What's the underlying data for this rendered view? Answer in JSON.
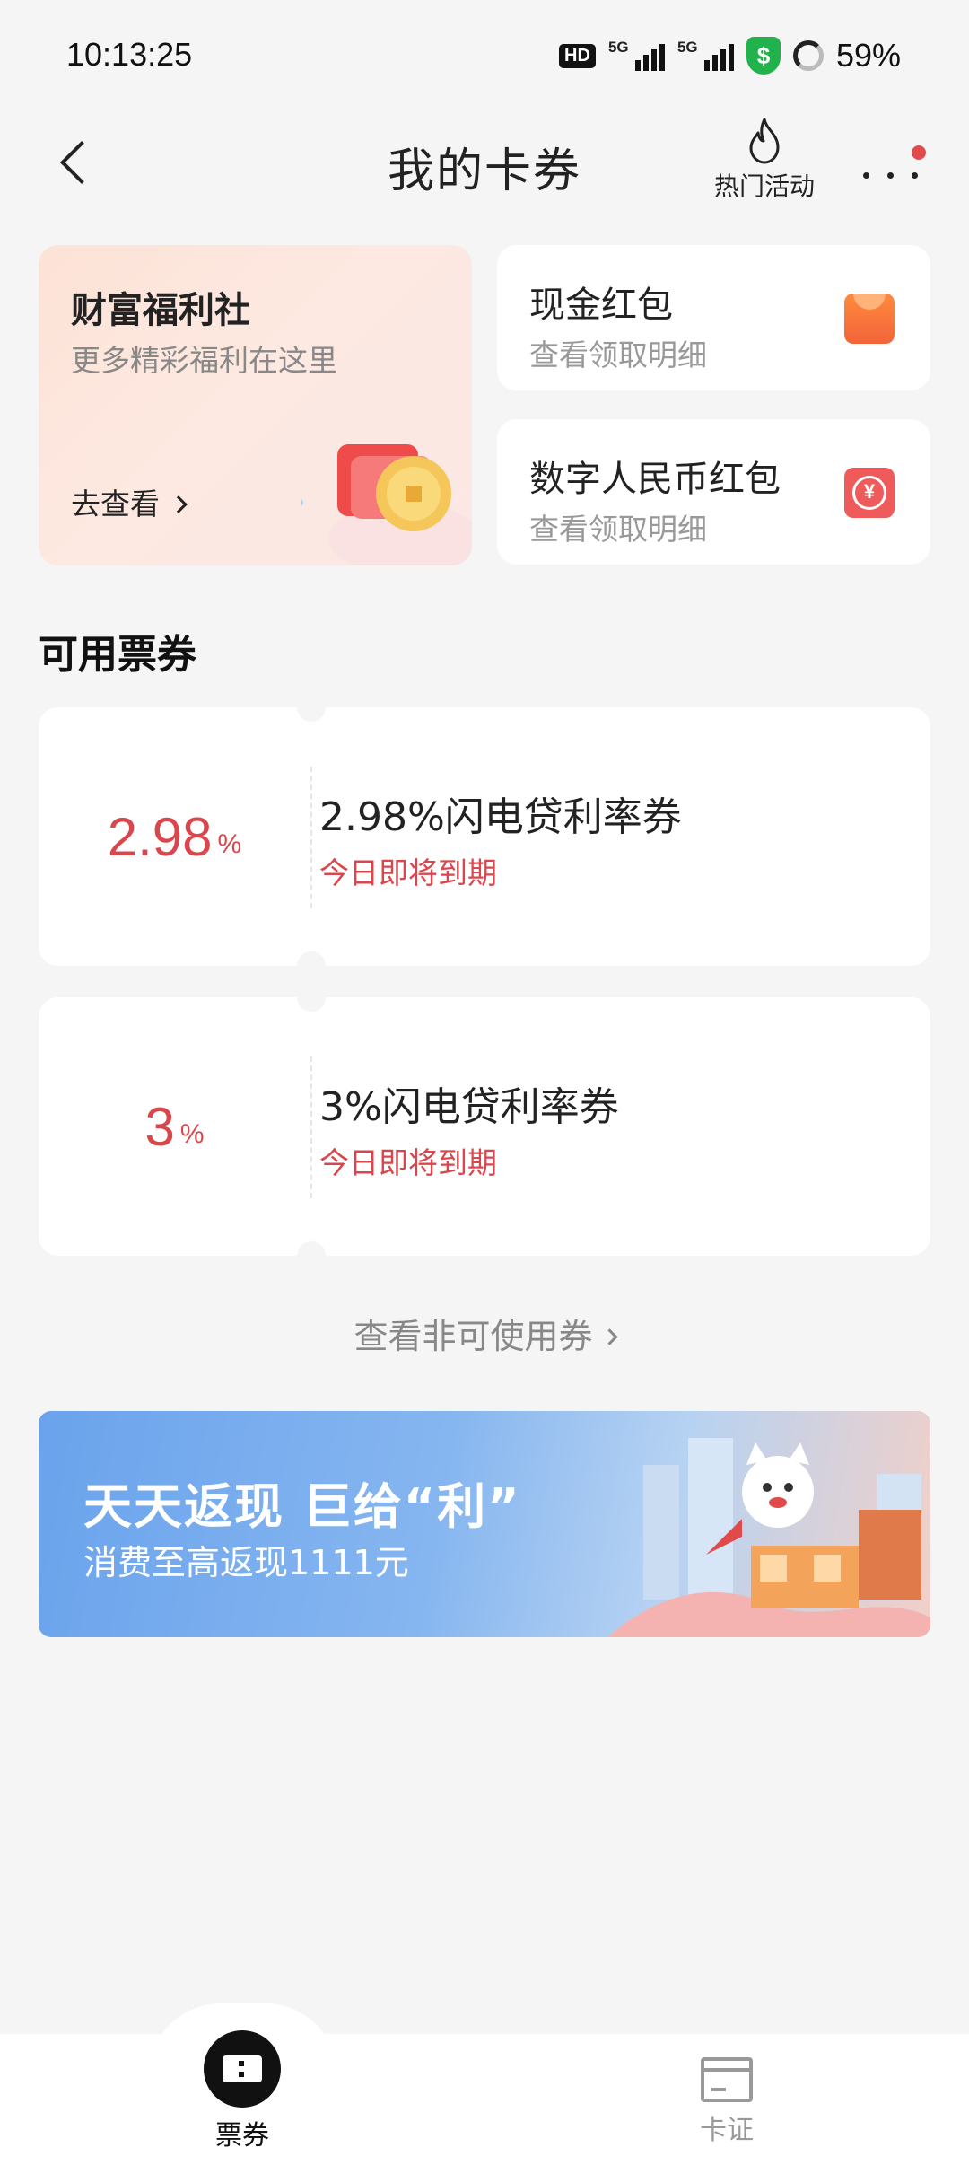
{
  "status_bar": {
    "time": "10:13:25",
    "hd_badge": "HD",
    "signal1_label": "5G",
    "signal2_label": "5G",
    "security_icon": "shield-dollar-icon",
    "battery_text": "59%",
    "shield_glyph": "$"
  },
  "nav": {
    "title": "我的卡券",
    "hot_label": "热门活动",
    "back_icon": "back-arrow-icon",
    "hot_icon": "flame-icon",
    "more_icon": "more-dots-icon"
  },
  "welfare": {
    "title": "财富福利社",
    "subtitle": "更多精彩福利在这里",
    "link": "去查看"
  },
  "mini_cards": [
    {
      "title": "现金红包",
      "subtitle": "查看领取明细",
      "icon": "red-packet-icon"
    },
    {
      "title": "数字人民币红包",
      "subtitle": "查看领取明细",
      "icon": "ecny-icon",
      "glyph": "¥"
    }
  ],
  "section_title": "可用票券",
  "coupons": [
    {
      "rate": "2.98",
      "unit": "%",
      "title": "2.98%闪电贷利率券",
      "expire": "今日即将到期"
    },
    {
      "rate": "3",
      "unit": "%",
      "title": "3%闪电贷利率券",
      "expire": "今日即将到期"
    }
  ],
  "view_unusable": "查看非可使用券",
  "banner": {
    "title": "天天返现 巨给“利”",
    "subtitle": "消费至高返现1111元"
  },
  "tabs": [
    {
      "label": "票券",
      "active": true,
      "icon": "ticket-icon"
    },
    {
      "label": "卡证",
      "active": false,
      "icon": "card-icon"
    }
  ],
  "colors": {
    "accent_red": "#d9474d",
    "background": "#f5f5f6",
    "card": "#ffffff"
  }
}
